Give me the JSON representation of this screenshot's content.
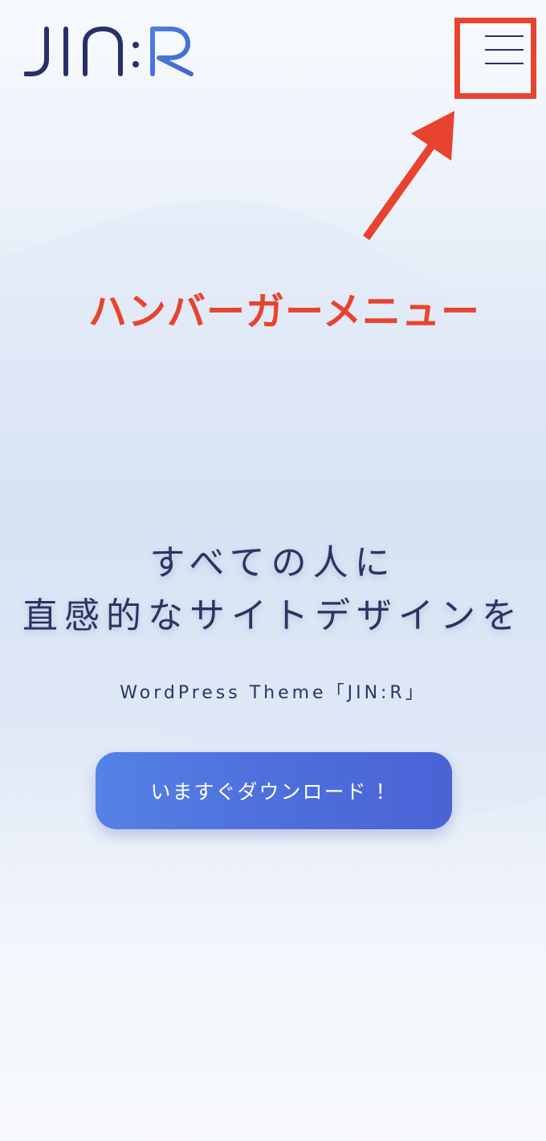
{
  "header": {
    "logo_text": "JIN:R",
    "menu_icon": "hamburger-menu-icon"
  },
  "annotation": {
    "label": "ハンバーガーメニュー",
    "color": "#e8432e"
  },
  "hero": {
    "line1": "すべての人に",
    "line2": "直感的なサイトデザインを",
    "subtitle": "WordPress Theme「JIN:R」",
    "cta_label": "いますぐダウンロード ！"
  },
  "colors": {
    "brand_dark": "#28306a",
    "brand_blue": "#4f7fe0",
    "cta_gradient_start": "#5482e6",
    "cta_gradient_end": "#4a63d6"
  }
}
